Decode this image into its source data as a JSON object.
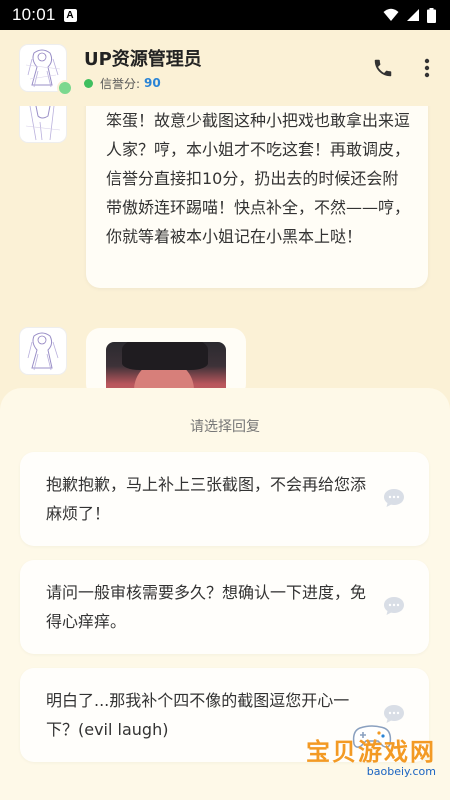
{
  "status_bar": {
    "time": "10:01",
    "notify_glyph": "A"
  },
  "header": {
    "title": "UP资源管理员",
    "credit_label": "信誉分:",
    "credit_value": "90",
    "icons": [
      "phone-icon",
      "more-vert-icon"
    ]
  },
  "chat": {
    "messages": [
      {
        "type": "text",
        "text": "笨蛋！故意少截图这种小把戏也敢拿出来逗人家？哼，本小姐才不吃这套！再敢调皮，信誉分直接扣10分，扔出去的时候还会附带傲娇连环踢喵！快点补全，不然——哼，你就等着被本小姐记在小黑本上哒！"
      },
      {
        "type": "image"
      }
    ]
  },
  "reply_sheet": {
    "title": "请选择回复",
    "options": [
      {
        "text": "抱歉抱歉，马上补上三张截图，不会再给您添麻烦了！"
      },
      {
        "text": "请问一般审核需要多久？想确认一下进度，免得心痒痒。"
      },
      {
        "text": "明白了...那我补个四不像的截图逗您开心一下？(evil laugh)"
      }
    ]
  },
  "watermark": {
    "text": "宝贝游戏网",
    "url": "baobeiy.com"
  },
  "colors": {
    "background": "#fbf1d6",
    "sheet": "#fef9e8",
    "online": "#3fbf5f",
    "credit": "#2a84d6",
    "watermark": "#f39a24"
  }
}
